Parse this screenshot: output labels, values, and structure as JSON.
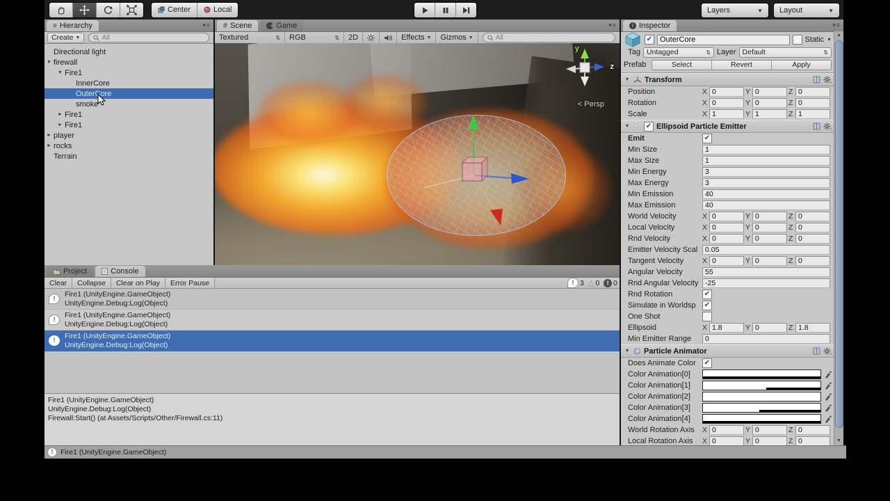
{
  "colors": {
    "selection": "#3e6db3",
    "panel": "#c8c8c8",
    "toolbar_bg": "#1d1d1d"
  },
  "toolbar": {
    "pivot": "Center",
    "space": "Local",
    "layers": "Layers",
    "layout": "Layout"
  },
  "hierarchy": {
    "tab": "Hierarchy",
    "create": "Create",
    "search": "All",
    "items": [
      {
        "label": "Directional light"
      },
      {
        "label": "firewall"
      },
      {
        "label": "Fire1"
      },
      {
        "label": "InnerCore"
      },
      {
        "label": "OuterCore"
      },
      {
        "label": "smoke"
      },
      {
        "label": "Fire1"
      },
      {
        "label": "Fire1"
      },
      {
        "label": "player"
      },
      {
        "label": "rocks"
      },
      {
        "label": "Terrain"
      }
    ]
  },
  "scene": {
    "tab_scene": "Scene",
    "tab_game": "Game",
    "draw_mode": "Textured",
    "color_mode": "RGB",
    "mode_2d": "2D",
    "effects": "Effects",
    "gizmos": "Gizmos",
    "search": "All",
    "axis_y": "y",
    "axis_z": "z",
    "persp": "Persp"
  },
  "console": {
    "tab_project": "Project",
    "tab_console": "Console",
    "clear": "Clear",
    "collapse": "Collapse",
    "clear_on_play": "Clear on Play",
    "error_pause": "Error Pause",
    "info_count": "3",
    "warn_count": "0",
    "error_count": "0",
    "entries": [
      {
        "line1": "Fire1 (UnityEngine.GameObject)",
        "line2": "UnityEngine.Debug:Log(Object)"
      },
      {
        "line1": "Fire1 (UnityEngine.GameObject)",
        "line2": "UnityEngine.Debug:Log(Object)"
      },
      {
        "line1": "Fire1 (UnityEngine.GameObject)",
        "line2": "UnityEngine.Debug:Log(Object)"
      }
    ],
    "detail": {
      "line1": "Fire1 (UnityEngine.GameObject)",
      "line2": "UnityEngine.Debug:Log(Object)",
      "line3": "Firewall:Start() (at Assets/Scripts/Other/Firewall.cs:11)"
    }
  },
  "statusbar": {
    "text": "Fire1 (UnityEngine.GameObject)"
  },
  "inspector": {
    "tab": "Inspector",
    "name": "OuterCore",
    "static_label": "Static",
    "tag_label": "Tag",
    "tag_value": "Untagged",
    "layer_label": "Layer",
    "layer_value": "Default",
    "prefab_label": "Prefab",
    "select": "Select",
    "revert": "Revert",
    "apply": "Apply",
    "axis": {
      "x": "X",
      "y": "Y",
      "z": "Z"
    },
    "transform": {
      "title": "Transform",
      "position": {
        "label": "Position",
        "x": "0",
        "y": "0",
        "z": "0"
      },
      "rotation": {
        "label": "Rotation",
        "x": "0",
        "y": "0",
        "z": "0"
      },
      "scale": {
        "label": "Scale",
        "x": "1",
        "y": "1",
        "z": "1"
      }
    },
    "emitter": {
      "title": "Ellipsoid Particle Emitter",
      "emit_label": "Emit",
      "min_size": {
        "label": "Min Size",
        "value": "1"
      },
      "max_size": {
        "label": "Max Size",
        "value": "1"
      },
      "min_energy": {
        "label": "Min Energy",
        "value": "3"
      },
      "max_energy": {
        "label": "Max Energy",
        "value": "3"
      },
      "min_emission": {
        "label": "Min Emission",
        "value": "40"
      },
      "max_emission": {
        "label": "Max Emission",
        "value": "40"
      },
      "world_velocity": {
        "label": "World Velocity",
        "x": "0",
        "y": "0",
        "z": "0"
      },
      "local_velocity": {
        "label": "Local Velocity",
        "x": "0",
        "y": "0",
        "z": "0"
      },
      "rnd_velocity": {
        "label": "Rnd Velocity",
        "x": "0",
        "y": "0",
        "z": "0"
      },
      "emitter_velocity_scale": {
        "label": "Emitter Velocity Scal",
        "value": "0.05"
      },
      "tangent_velocity": {
        "label": "Tangent Velocity",
        "x": "0",
        "y": "0",
        "z": "0"
      },
      "angular_velocity": {
        "label": "Angular Velocity",
        "value": "55"
      },
      "rnd_angular_velocity": {
        "label": "Rnd Angular Velocity",
        "value": "-25"
      },
      "rnd_rotation_label": "Rnd Rotation",
      "simulate_label": "Simulate in Worldsp",
      "one_shot_label": "One Shot",
      "ellipsoid": {
        "label": "Ellipsoid",
        "x": "1.8",
        "y": "0",
        "z": "1.8"
      },
      "min_emitter_range": {
        "label": "Min Emitter Range",
        "value": "0"
      }
    },
    "animator": {
      "title": "Particle Animator",
      "does_animate_label": "Does Animate Color",
      "color_slots": [
        {
          "label": "Color Animation[0]"
        },
        {
          "label": "Color Animation[1]"
        },
        {
          "label": "Color Animation[2]"
        },
        {
          "label": "Color Animation[3]"
        },
        {
          "label": "Color Animation[4]"
        }
      ],
      "world_rotation": {
        "label": "World Rotation Axis",
        "x": "0",
        "y": "0",
        "z": "0"
      },
      "local_rotation": {
        "label": "Local Rotation Axis",
        "x": "0",
        "y": "0",
        "z": "0"
      }
    }
  }
}
